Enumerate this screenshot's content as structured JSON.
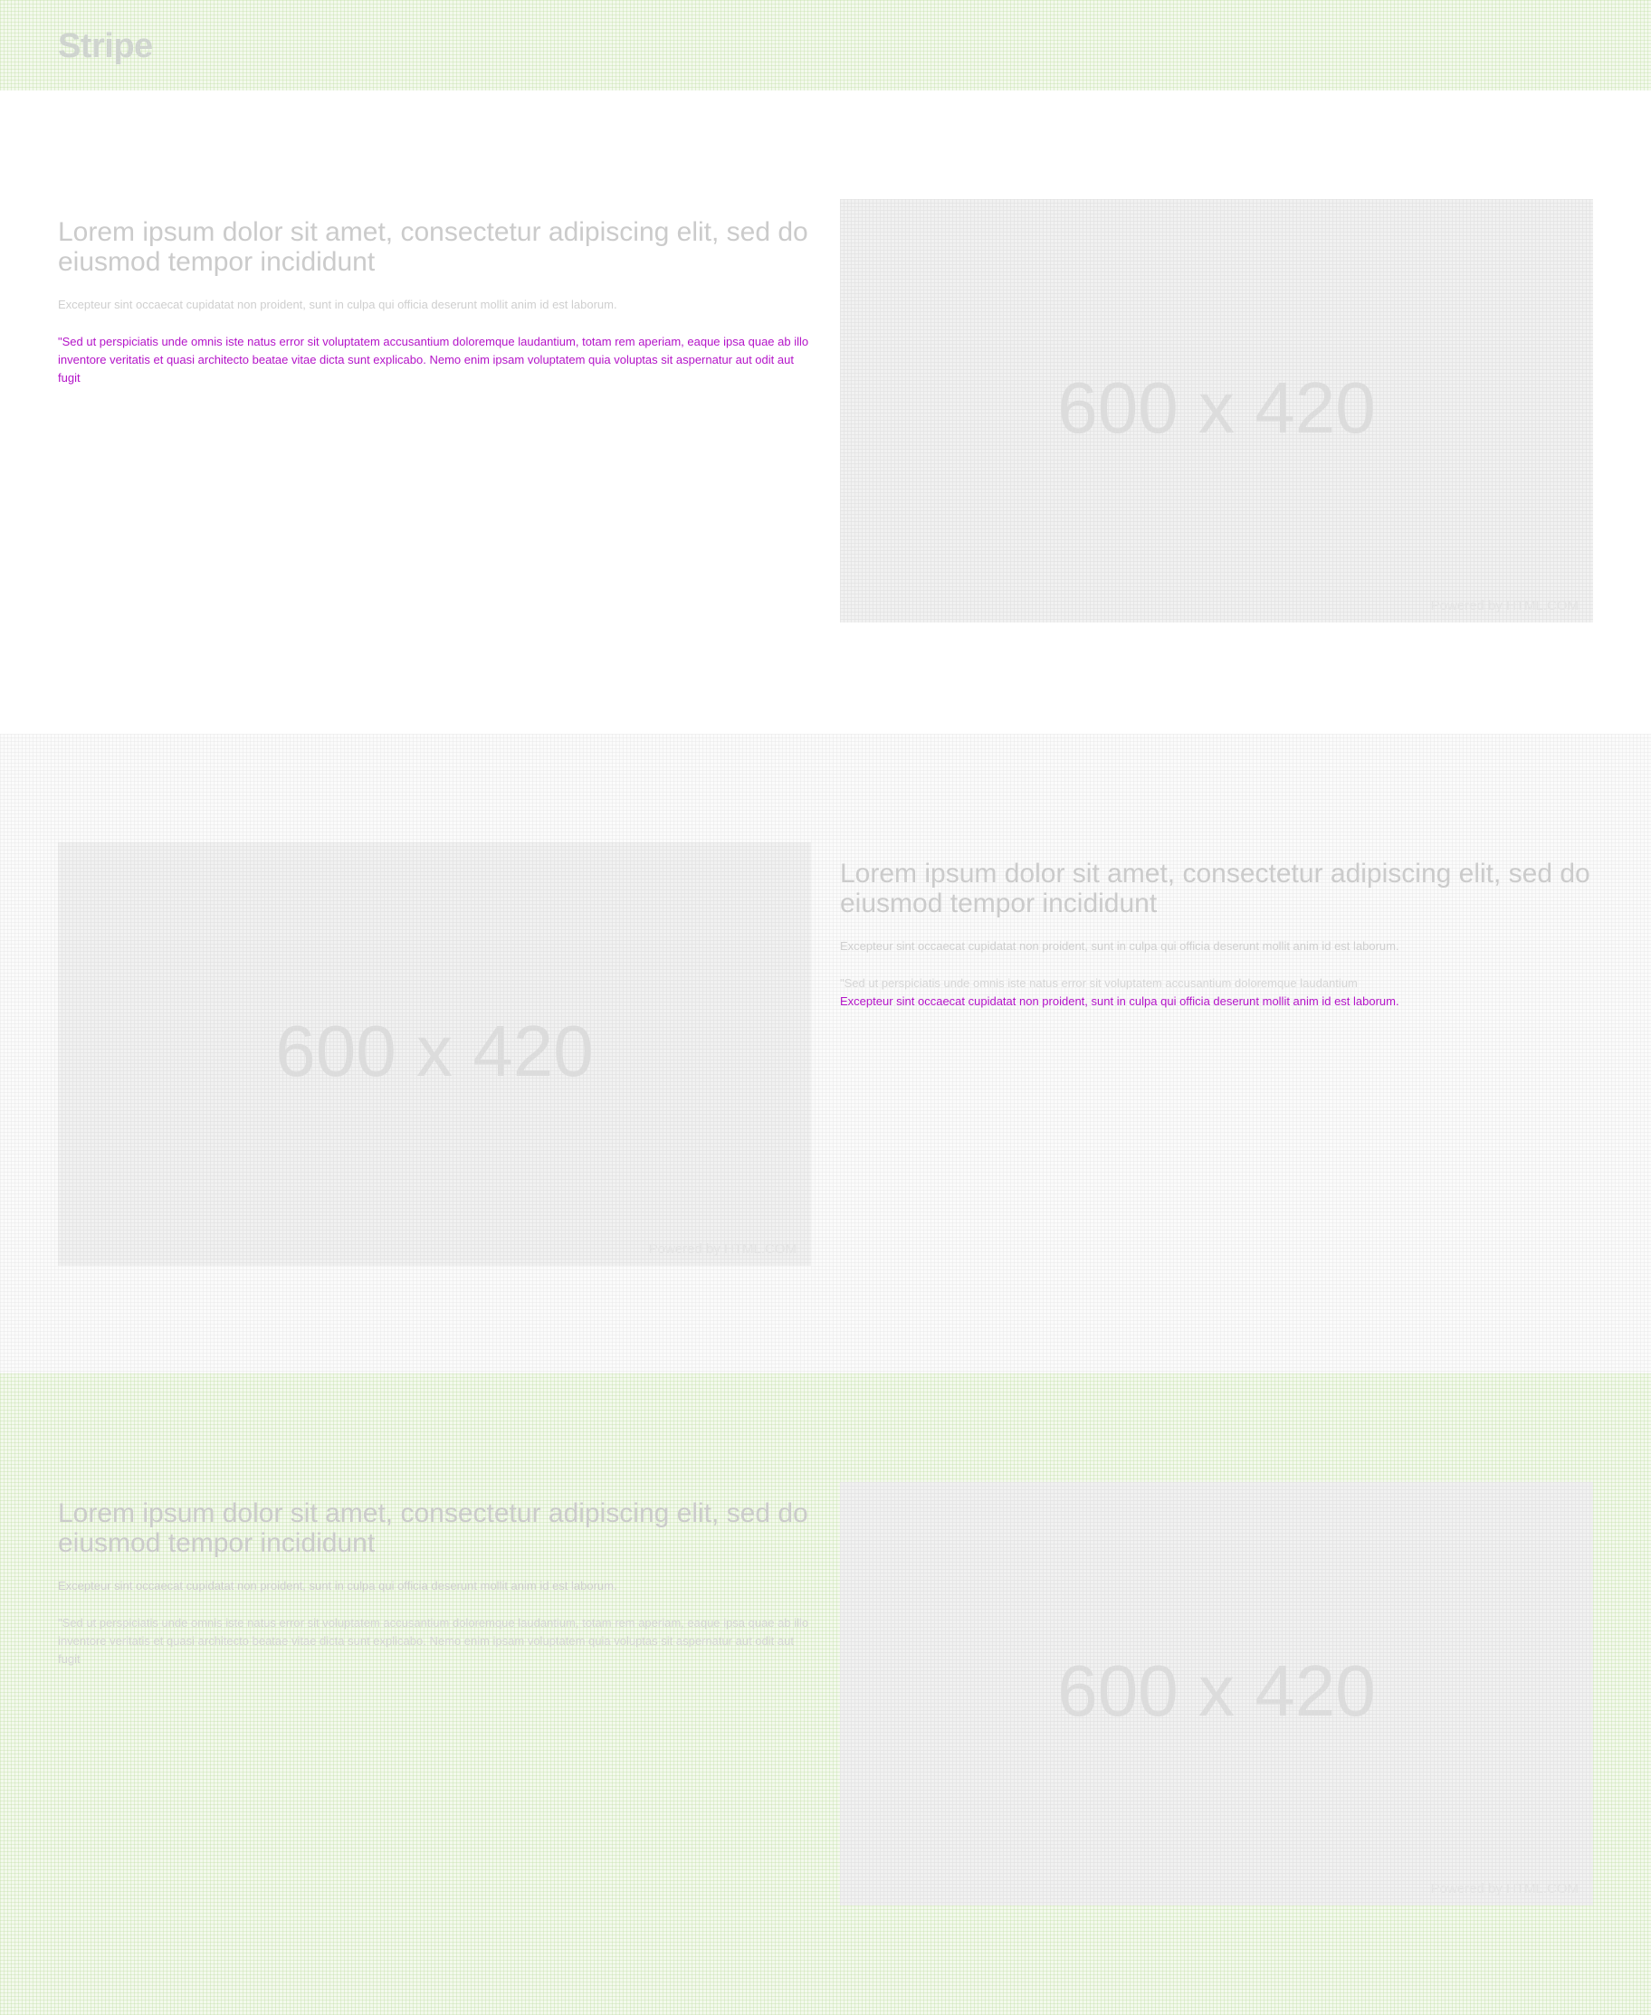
{
  "header": {
    "brand": "Stripe"
  },
  "sections": [
    {
      "heading": "Lorem ipsum dolor sit amet, consectetur adipiscing elit, sed do eiusmod tempor incididunt",
      "lead": "Excepteur sint occaecat cupidatat non proident, sunt in culpa qui officia deserunt mollit anim id est laborum.",
      "quote": "\"Sed ut perspiciatis unde omnis iste natus error sit voluptatem accusantium doloremque laudantium, totam rem aperiam, eaque ipsa quae ab illo inventore veritatis et quasi architecto beatae vitae dicta sunt explicabo. Nemo enim ipsam voluptatem quia voluptas sit aspernatur aut odit aut fugit",
      "image": {
        "dimensions": "600 x 420",
        "credit": "Powered by HTML.COM"
      }
    },
    {
      "heading": "Lorem ipsum dolor sit amet, consectetur adipiscing elit, sed do eiusmod tempor incididunt",
      "lead": "Excepteur sint occaecat cupidatat non proident, sunt in culpa qui officia deserunt mollit anim id est laborum.",
      "quote_line1": "\"Sed ut perspiciatis unde omnis iste natus error sit voluptatem accusantium doloremque laudantium",
      "quote_line2": "Excepteur sint occaecat cupidatat non proident, sunt in culpa qui officia deserunt mollit anim id est laborum.",
      "image": {
        "dimensions": "600 x 420",
        "credit": "Powered by HTML.COM"
      }
    },
    {
      "heading": "Lorem ipsum dolor sit amet, consectetur adipiscing elit, sed do eiusmod tempor incididunt",
      "lead": "Excepteur sint occaecat cupidatat non proident, sunt in culpa qui officia deserunt mollit anim id est laborum.",
      "quote": "\"Sed ut perspiciatis unde omnis iste natus error sit voluptatem accusantium doloremque laudantium, totam rem aperiam, eaque ipsa quae ab illo inventore veritatis et quasi architecto beatae vitae dicta sunt explicabo. Nemo enim ipsam voluptatem quia voluptas sit aspernatur aut odit aut fugit",
      "image": {
        "dimensions": "600 x 420",
        "credit": "Powered by HTML.COM"
      }
    }
  ],
  "colors": {
    "accent": "#b414c8",
    "band_green": "#f3f9ec",
    "band_grey": "#fbfbfb",
    "placeholder": "#f1f1f1"
  }
}
